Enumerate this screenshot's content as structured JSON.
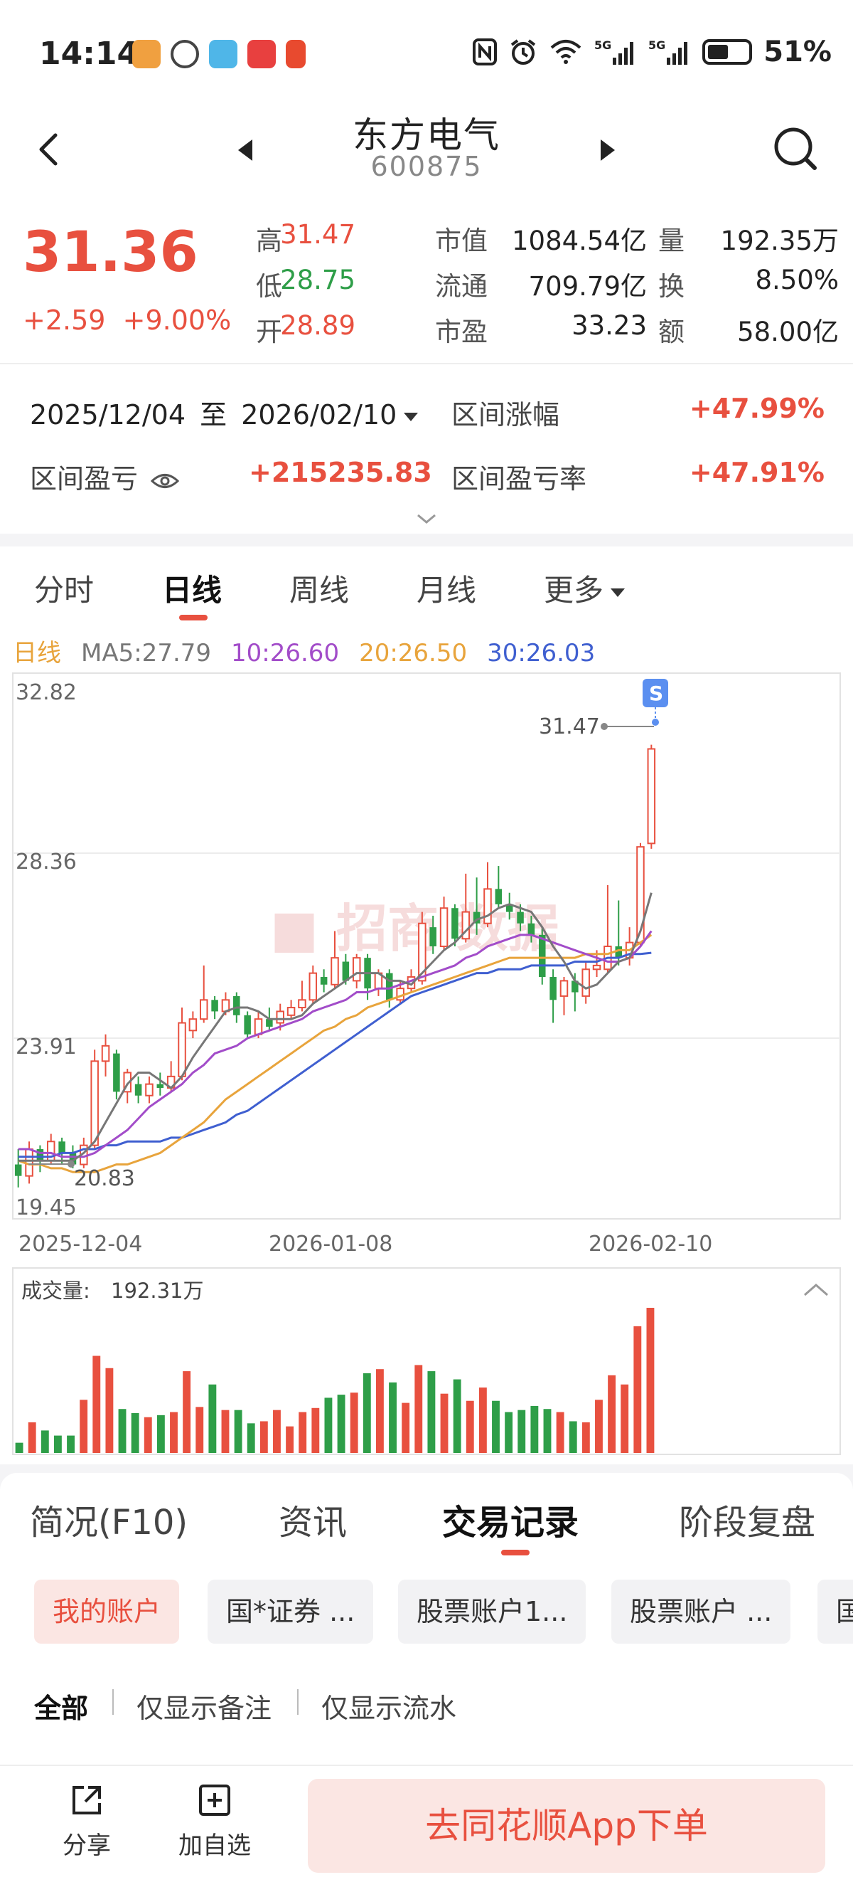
{
  "status_bar": {
    "time": "14:14",
    "network": "5G",
    "battery": "51%"
  },
  "header": {
    "stock_name": "东方电气",
    "stock_code": "600875"
  },
  "quote": {
    "price": "31.36",
    "change": "+2.59",
    "change_pct": "+9.00%",
    "high_label": "高",
    "high": "31.47",
    "low_label": "低",
    "low": "28.75",
    "open_label": "开",
    "open": "28.89",
    "mkt_cap_label": "市值",
    "mkt_cap": "1084.54亿",
    "float_cap_label": "流通",
    "float_cap": "709.79亿",
    "pe_label": "市盈",
    "pe": "33.23",
    "volume_label": "量",
    "volume": "192.35万",
    "turnover_label": "换",
    "turnover": "8.50%",
    "amount_label": "额",
    "amount": "58.00亿"
  },
  "range": {
    "start": "2025/12/04",
    "sep": "至",
    "end": "2026/02/10",
    "gain_label": "区间涨幅",
    "gain": "+47.99%",
    "pl_label": "区间盈亏",
    "pl": "+215235.83",
    "pl_rate_label": "区间盈亏率",
    "pl_rate": "+47.91%"
  },
  "chart_tabs": [
    "分时",
    "日线",
    "周线",
    "月线",
    "更多"
  ],
  "ma": {
    "label": "日线",
    "ma5": "MA5:27.79",
    "ma10": "10:26.60",
    "ma20": "20:26.50",
    "ma30": "30:26.03"
  },
  "price_axis": {
    "ticks": [
      "32.82",
      "28.36",
      "23.91",
      "19.45"
    ],
    "high_marker": "31.47",
    "low_marker": "20.83",
    "dates": [
      "2025-12-04",
      "2026-01-08",
      "2026-02-10"
    ],
    "sell_marker": "S"
  },
  "volume": {
    "label": "成交量:",
    "value": "192.31万"
  },
  "chart_data": {
    "type": "candlestick",
    "ylim": [
      19.45,
      32.82
    ],
    "candles": [
      {
        "o": 20.5,
        "c": 20.2,
        "h": 20.9,
        "l": 19.9
      },
      {
        "o": 20.2,
        "c": 20.9,
        "h": 21.1,
        "l": 20.0
      },
      {
        "o": 20.9,
        "c": 20.6,
        "h": 21.0,
        "l": 20.3
      },
      {
        "o": 20.6,
        "c": 21.1,
        "h": 21.3,
        "l": 20.5
      },
      {
        "o": 21.1,
        "c": 20.8,
        "h": 21.2,
        "l": 20.5
      },
      {
        "o": 20.8,
        "c": 20.5,
        "h": 21.0,
        "l": 20.4
      },
      {
        "o": 20.5,
        "c": 21.0,
        "h": 21.2,
        "l": 20.4
      },
      {
        "o": 21.0,
        "c": 23.2,
        "h": 23.5,
        "l": 20.9
      },
      {
        "o": 23.2,
        "c": 23.6,
        "h": 23.9,
        "l": 22.8
      },
      {
        "o": 23.4,
        "c": 22.4,
        "h": 23.5,
        "l": 22.2
      },
      {
        "o": 22.4,
        "c": 22.9,
        "h": 23.0,
        "l": 22.1
      },
      {
        "o": 22.6,
        "c": 22.3,
        "h": 22.8,
        "l": 22.1
      },
      {
        "o": 22.3,
        "c": 22.6,
        "h": 22.8,
        "l": 22.1
      },
      {
        "o": 22.6,
        "c": 22.5,
        "h": 22.9,
        "l": 22.3
      },
      {
        "o": 22.5,
        "c": 22.8,
        "h": 23.2,
        "l": 22.4
      },
      {
        "o": 22.8,
        "c": 24.2,
        "h": 24.6,
        "l": 22.7
      },
      {
        "o": 24.0,
        "c": 24.3,
        "h": 24.5,
        "l": 23.8
      },
      {
        "o": 24.3,
        "c": 24.8,
        "h": 25.7,
        "l": 24.2
      },
      {
        "o": 24.8,
        "c": 24.5,
        "h": 24.9,
        "l": 24.3
      },
      {
        "o": 24.5,
        "c": 24.8,
        "h": 25.0,
        "l": 24.4
      },
      {
        "o": 24.9,
        "c": 24.4,
        "h": 25.0,
        "l": 24.2
      },
      {
        "o": 24.4,
        "c": 23.9,
        "h": 24.5,
        "l": 23.8
      },
      {
        "o": 23.9,
        "c": 24.3,
        "h": 24.5,
        "l": 23.8
      },
      {
        "o": 24.3,
        "c": 24.1,
        "h": 24.6,
        "l": 24.0
      },
      {
        "o": 24.2,
        "c": 24.5,
        "h": 24.7,
        "l": 24.0
      },
      {
        "o": 24.4,
        "c": 24.6,
        "h": 24.8,
        "l": 24.3
      },
      {
        "o": 24.6,
        "c": 24.8,
        "h": 25.3,
        "l": 24.5
      },
      {
        "o": 24.8,
        "c": 25.5,
        "h": 25.7,
        "l": 24.7
      },
      {
        "o": 25.4,
        "c": 25.2,
        "h": 25.6,
        "l": 25.0
      },
      {
        "o": 25.2,
        "c": 25.9,
        "h": 26.6,
        "l": 25.1
      },
      {
        "o": 25.8,
        "c": 25.3,
        "h": 26.0,
        "l": 25.2
      },
      {
        "o": 25.3,
        "c": 25.9,
        "h": 26.0,
        "l": 25.1
      },
      {
        "o": 25.9,
        "c": 25.1,
        "h": 26.0,
        "l": 24.8
      },
      {
        "o": 25.1,
        "c": 25.5,
        "h": 25.6,
        "l": 24.9
      },
      {
        "o": 25.5,
        "c": 24.8,
        "h": 25.6,
        "l": 24.6
      },
      {
        "o": 24.8,
        "c": 25.1,
        "h": 25.3,
        "l": 24.7
      },
      {
        "o": 25.1,
        "c": 25.4,
        "h": 25.6,
        "l": 25.0
      },
      {
        "o": 25.3,
        "c": 26.8,
        "h": 27.1,
        "l": 25.2
      },
      {
        "o": 26.7,
        "c": 26.2,
        "h": 27.0,
        "l": 26.0
      },
      {
        "o": 26.2,
        "c": 27.2,
        "h": 27.5,
        "l": 26.1
      },
      {
        "o": 27.2,
        "c": 26.4,
        "h": 27.3,
        "l": 26.2
      },
      {
        "o": 26.4,
        "c": 27.1,
        "h": 28.1,
        "l": 26.3
      },
      {
        "o": 27.1,
        "c": 26.8,
        "h": 28.0,
        "l": 26.5
      },
      {
        "o": 26.8,
        "c": 27.7,
        "h": 28.4,
        "l": 26.7
      },
      {
        "o": 27.7,
        "c": 27.3,
        "h": 28.3,
        "l": 27.2
      },
      {
        "o": 27.3,
        "c": 27.1,
        "h": 27.6,
        "l": 26.9
      },
      {
        "o": 27.1,
        "c": 26.8,
        "h": 27.3,
        "l": 26.6
      },
      {
        "o": 26.8,
        "c": 26.5,
        "h": 27.0,
        "l": 26.3
      },
      {
        "o": 26.5,
        "c": 25.4,
        "h": 26.7,
        "l": 25.2
      },
      {
        "o": 25.4,
        "c": 24.8,
        "h": 25.6,
        "l": 24.2
      },
      {
        "o": 24.9,
        "c": 25.3,
        "h": 25.4,
        "l": 24.4
      },
      {
        "o": 25.3,
        "c": 25.0,
        "h": 25.5,
        "l": 24.5
      },
      {
        "o": 24.9,
        "c": 25.6,
        "h": 25.8,
        "l": 24.7
      },
      {
        "o": 25.6,
        "c": 25.7,
        "h": 26.1,
        "l": 25.4
      },
      {
        "o": 25.6,
        "c": 26.2,
        "h": 27.8,
        "l": 25.5
      },
      {
        "o": 26.2,
        "c": 25.9,
        "h": 27.4,
        "l": 25.7
      },
      {
        "o": 25.9,
        "c": 26.3,
        "h": 26.7,
        "l": 25.7
      },
      {
        "o": 26.3,
        "c": 28.8,
        "h": 28.9,
        "l": 26.2
      },
      {
        "o": 28.89,
        "c": 31.36,
        "h": 31.47,
        "l": 28.75
      }
    ],
    "ma5": [
      20.6,
      20.6,
      20.6,
      20.6,
      20.6,
      20.6,
      20.8,
      21.1,
      21.6,
      22.1,
      22.6,
      22.9,
      22.9,
      22.7,
      22.5,
      22.8,
      23.3,
      23.7,
      24.1,
      24.5,
      24.6,
      24.6,
      24.5,
      24.3,
      24.3,
      24.3,
      24.4,
      24.7,
      24.9,
      25.1,
      25.3,
      25.5,
      25.5,
      25.5,
      25.3,
      25.3,
      25.2,
      25.5,
      25.8,
      26.1,
      26.3,
      26.6,
      26.9,
      27.0,
      27.2,
      27.3,
      27.2,
      27.1,
      26.7,
      26.2,
      25.8,
      25.3,
      25.1,
      25.2,
      25.5,
      25.8,
      25.9,
      26.6,
      27.6
    ],
    "ma10": [
      20.9,
      20.9,
      20.8,
      20.8,
      20.7,
      20.7,
      20.7,
      20.8,
      21.0,
      21.2,
      21.4,
      21.7,
      22.0,
      22.2,
      22.4,
      22.6,
      22.9,
      23.1,
      23.4,
      23.5,
      23.6,
      23.8,
      23.9,
      24.0,
      24.1,
      24.2,
      24.3,
      24.5,
      24.6,
      24.7,
      24.8,
      25.0,
      25.0,
      25.1,
      25.1,
      25.2,
      25.3,
      25.4,
      25.5,
      25.6,
      25.7,
      25.9,
      26.0,
      26.2,
      26.3,
      26.4,
      26.5,
      26.5,
      26.4,
      26.3,
      26.2,
      26.1,
      26.0,
      25.9,
      25.8,
      25.8,
      25.9,
      26.2,
      26.6
    ],
    "ma20": [
      20.6,
      20.5,
      20.5,
      20.4,
      20.4,
      20.3,
      20.3,
      20.3,
      20.4,
      20.5,
      20.5,
      20.6,
      20.7,
      20.8,
      21.0,
      21.2,
      21.4,
      21.6,
      21.9,
      22.2,
      22.4,
      22.6,
      22.8,
      23.0,
      23.2,
      23.4,
      23.6,
      23.8,
      24.0,
      24.1,
      24.3,
      24.4,
      24.6,
      24.7,
      24.8,
      24.9,
      25.0,
      25.1,
      25.2,
      25.3,
      25.4,
      25.5,
      25.6,
      25.7,
      25.8,
      25.9,
      25.9,
      25.9,
      25.9,
      25.9,
      25.9,
      25.9,
      26.0,
      26.0,
      26.0,
      26.1,
      26.1,
      26.3,
      26.5
    ],
    "ma30": [
      20.7,
      20.7,
      20.7,
      20.7,
      20.8,
      20.8,
      20.9,
      20.9,
      21.0,
      21.0,
      21.1,
      21.1,
      21.1,
      21.1,
      21.2,
      21.2,
      21.3,
      21.4,
      21.5,
      21.6,
      21.8,
      21.9,
      22.1,
      22.3,
      22.5,
      22.7,
      22.9,
      23.1,
      23.3,
      23.5,
      23.7,
      23.9,
      24.1,
      24.3,
      24.5,
      24.7,
      24.9,
      25.0,
      25.1,
      25.2,
      25.3,
      25.4,
      25.5,
      25.5,
      25.6,
      25.6,
      25.6,
      25.7,
      25.7,
      25.7,
      25.7,
      25.8,
      25.8,
      25.8,
      25.9,
      25.9,
      26.0,
      26.0,
      26.03
    ],
    "volumes": [
      10,
      30,
      22,
      17,
      17,
      52,
      95,
      83,
      43,
      39,
      35,
      37,
      40,
      80,
      45,
      67,
      42,
      42,
      29,
      31,
      42,
      26,
      40,
      44,
      54,
      57,
      59,
      78,
      82,
      69,
      49,
      86,
      80,
      58,
      72,
      51,
      64,
      51,
      40,
      42,
      46,
      43,
      40,
      31,
      30,
      52,
      76,
      67,
      124,
      142
    ],
    "volume_ylim": [
      0,
      142
    ]
  },
  "info_tabs": [
    "简况(F10)",
    "资讯",
    "交易记录",
    "阶段复盘"
  ],
  "accounts": [
    "我的账户",
    "国*证券 ...",
    "股票账户1...",
    "股票账户 ...",
    "国"
  ],
  "filters": [
    "全部",
    "仅显示备注",
    "仅显示流水"
  ],
  "bottom": {
    "share": "分享",
    "add_watch": "加自选",
    "order": "去同花顺App下单"
  },
  "colors": {
    "up": "#e8503f",
    "down": "#2e9e48",
    "ma5": "#777777",
    "ma10": "#a24cc9",
    "ma20": "#e8a43c",
    "ma30": "#3f5fd0"
  }
}
